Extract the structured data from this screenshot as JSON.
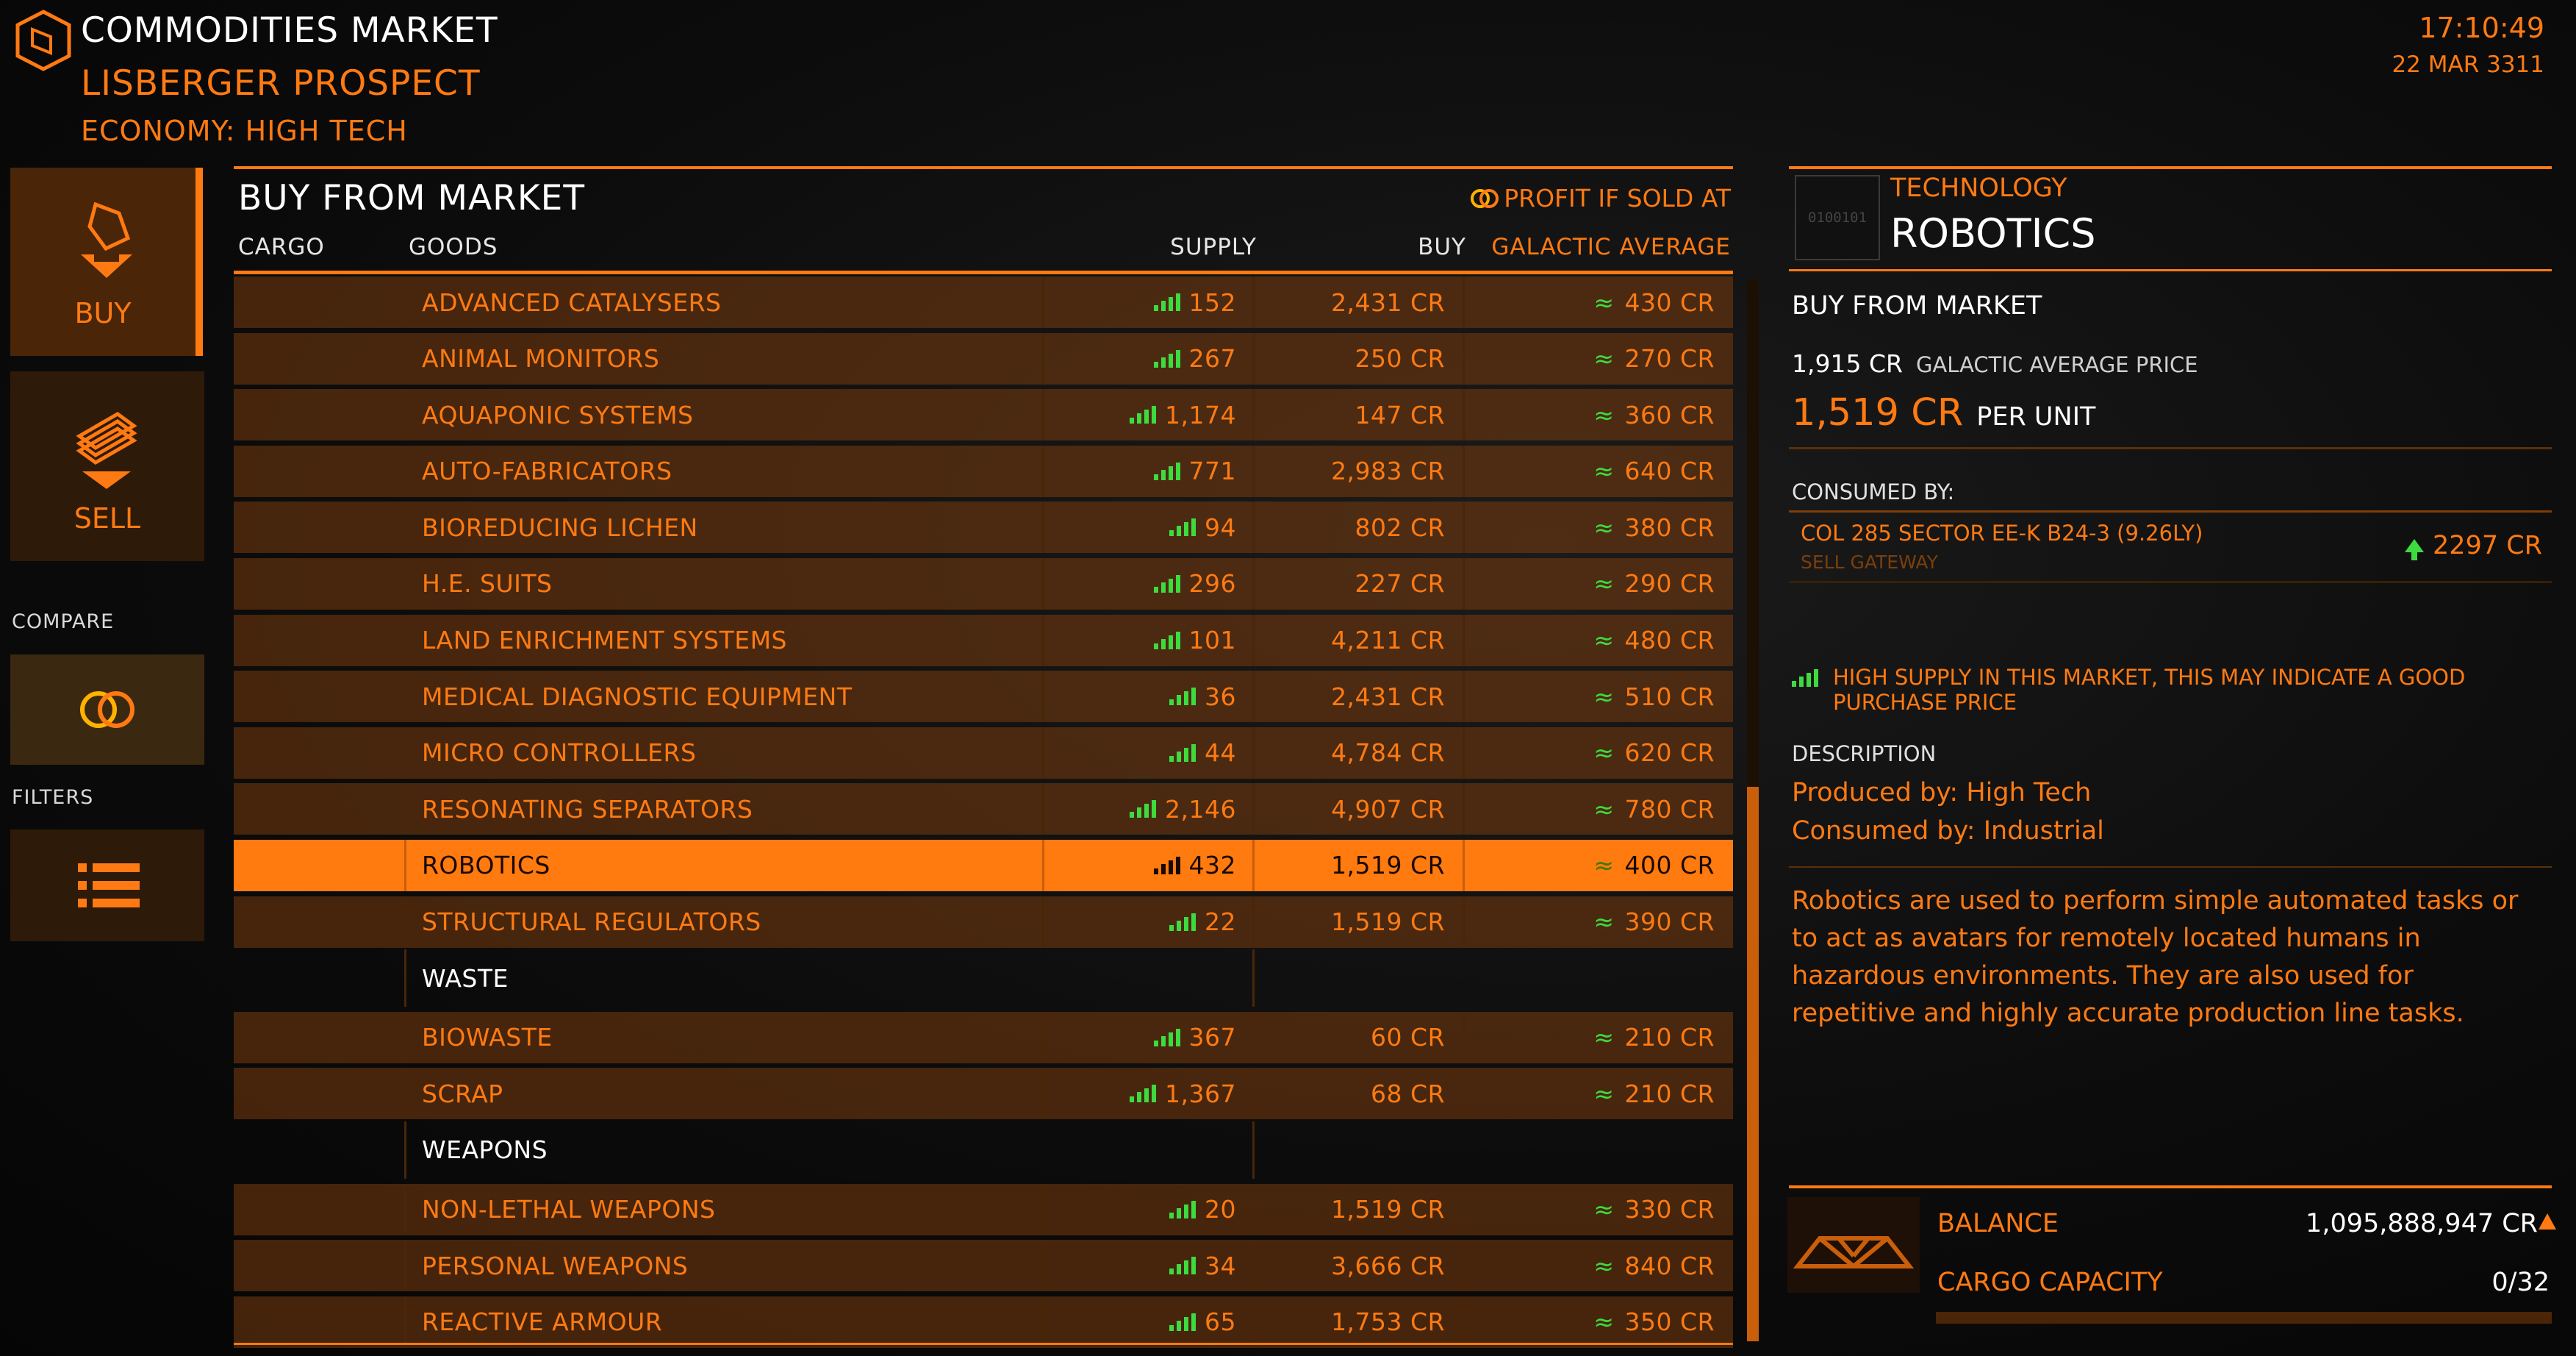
{
  "header": {
    "title": "COMMODITIES MARKET",
    "station": "LISBERGER PROSPECT",
    "economy": "ECONOMY: HIGH TECH",
    "time": "17:10:49",
    "date": "22 MAR 3311"
  },
  "nav": {
    "buy_label": "BUY",
    "sell_label": "SELL",
    "compare_caption": "COMPARE",
    "filters_caption": "FILTERS"
  },
  "market": {
    "title": "BUY FROM MARKET",
    "profit_label": "PROFIT IF SOLD AT",
    "columns": {
      "cargo": "CARGO",
      "goods": "GOODS",
      "supply": "SUPPLY",
      "buy": "BUY",
      "avg": "GALACTIC AVERAGE"
    },
    "rows": [
      {
        "type": "item",
        "name": "ADVANCED CATALYSERS",
        "supply": "152",
        "buy": "2,431 CR",
        "avg": "430 CR"
      },
      {
        "type": "item",
        "name": "ANIMAL MONITORS",
        "supply": "267",
        "buy": "250 CR",
        "avg": "270 CR"
      },
      {
        "type": "item",
        "name": "AQUAPONIC SYSTEMS",
        "supply": "1,174",
        "buy": "147 CR",
        "avg": "360 CR"
      },
      {
        "type": "item",
        "name": "AUTO-FABRICATORS",
        "supply": "771",
        "buy": "2,983 CR",
        "avg": "640 CR"
      },
      {
        "type": "item",
        "name": "BIOREDUCING LICHEN",
        "supply": "94",
        "buy": "802 CR",
        "avg": "380 CR"
      },
      {
        "type": "item",
        "name": "H.E. SUITS",
        "supply": "296",
        "buy": "227 CR",
        "avg": "290 CR"
      },
      {
        "type": "item",
        "name": "LAND ENRICHMENT SYSTEMS",
        "supply": "101",
        "buy": "4,211 CR",
        "avg": "480 CR"
      },
      {
        "type": "item",
        "name": "MEDICAL DIAGNOSTIC EQUIPMENT",
        "supply": "36",
        "buy": "2,431 CR",
        "avg": "510 CR"
      },
      {
        "type": "item",
        "name": "MICRO CONTROLLERS",
        "supply": "44",
        "buy": "4,784 CR",
        "avg": "620 CR"
      },
      {
        "type": "item",
        "name": "RESONATING SEPARATORS",
        "supply": "2,146",
        "buy": "4,907 CR",
        "avg": "780 CR"
      },
      {
        "type": "item",
        "name": "ROBOTICS",
        "supply": "432",
        "buy": "1,519 CR",
        "avg": "400 CR",
        "selected": true
      },
      {
        "type": "item",
        "name": "STRUCTURAL REGULATORS",
        "supply": "22",
        "buy": "1,519 CR",
        "avg": "390 CR"
      },
      {
        "type": "category",
        "name": "WASTE"
      },
      {
        "type": "item",
        "name": "BIOWASTE",
        "supply": "367",
        "buy": "60 CR",
        "avg": "210 CR"
      },
      {
        "type": "item",
        "name": "SCRAP",
        "supply": "1,367",
        "buy": "68 CR",
        "avg": "210 CR"
      },
      {
        "type": "category",
        "name": "WEAPONS"
      },
      {
        "type": "item",
        "name": "NON-LETHAL WEAPONS",
        "supply": "20",
        "buy": "1,519 CR",
        "avg": "330 CR"
      },
      {
        "type": "item",
        "name": "PERSONAL WEAPONS",
        "supply": "34",
        "buy": "3,666 CR",
        "avg": "840 CR"
      },
      {
        "type": "item",
        "name": "REACTIVE ARMOUR",
        "supply": "65",
        "buy": "1,753 CR",
        "avg": "350 CR"
      }
    ]
  },
  "detail": {
    "icon_text": "0100101",
    "category": "TECHNOLOGY",
    "name": "ROBOTICS",
    "buy_header": "BUY FROM MARKET",
    "avg_price": "1,915 CR",
    "avg_price_label": "GALACTIC AVERAGE PRICE",
    "unit_price": "1,519 CR",
    "unit_price_label": "PER UNIT",
    "consumed_by_label": "CONSUMED BY:",
    "consumer_name": "COL 285 SECTOR EE-K B24-3 (9.26LY)",
    "consumer_station": "SELL GATEWAY",
    "consumer_price": "2297 CR",
    "supply_hint": "HIGH SUPPLY IN THIS MARKET, THIS MAY INDICATE A GOOD PURCHASE PRICE",
    "description_label": "DESCRIPTION",
    "produced_by": "Produced by: High Tech",
    "consumed_by": "Consumed by: Industrial",
    "description": "Robotics are used to perform simple automated tasks or to act as avatars for remotely located humans in hazardous environments. They are also used for repetitive and highly accurate production line tasks."
  },
  "footer": {
    "balance_label": "BALANCE",
    "balance_value": "1,095,888,947 CR",
    "cargo_label": "CARGO CAPACITY",
    "cargo_value": "0/32",
    "cargo_fill": 0
  },
  "colors": {
    "accent": "#ff7a12",
    "supply_green": "#3edb3e",
    "text_white": "#ffffff"
  }
}
